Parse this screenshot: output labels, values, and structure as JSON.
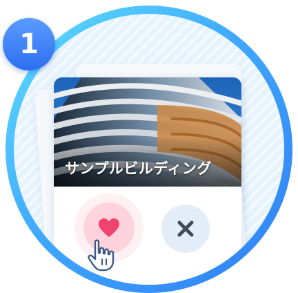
{
  "step": {
    "number": "1"
  },
  "card": {
    "title": "サンプルビルディング"
  },
  "actions": {
    "like_icon": "heart-icon",
    "skip_icon": "close-icon"
  },
  "colors": {
    "ring": "#3fa9ff",
    "badge": "#2d6ff0",
    "like": "#f0446e",
    "skip": "#424a5a"
  }
}
